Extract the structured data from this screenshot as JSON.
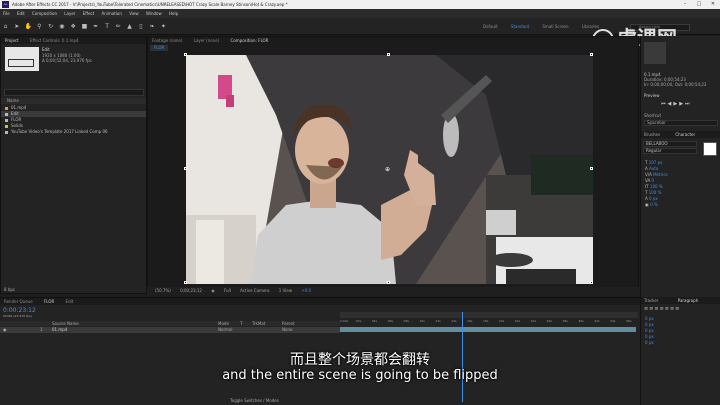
{
  "app": {
    "title": "Adobe After Effects CC 2017 - V:\\Projects\\_YouTube\\Tolerated Cinematics\\UNRELEASED\\HOT Crazy Scale Barney Stinson\\Hot & Crazy.aep *",
    "logo_text": "Ae"
  },
  "menu": [
    "File",
    "Edit",
    "Composition",
    "Layer",
    "Effect",
    "Animation",
    "View",
    "Window",
    "Help"
  ],
  "workspaces": {
    "items": [
      "Default",
      "Standard",
      "Small Screen",
      "Libraries"
    ],
    "active_index": 1,
    "search_placeholder": "Search Help"
  },
  "project_panel": {
    "tabs": [
      "Project",
      "Effect Controls: 0.1.mp4"
    ],
    "selected_name": "Edit",
    "selected_info_1": "1920 x 1080 (1.00)",
    "selected_info_2": "Δ 0;00;52;04, 23.976 fps",
    "header_name": "Name",
    "items": [
      {
        "name": "01.mp4",
        "color": "#d4a23a",
        "selected": false
      },
      {
        "name": "Edit",
        "color": "#b8b8b8",
        "selected": true
      },
      {
        "name": "FLOR",
        "color": "#b8b8b8",
        "selected": false
      },
      {
        "name": "Solids",
        "color": "#d4c23a",
        "selected": false
      },
      {
        "name": "YouTube Video's Template 2017 Linked Comp 06",
        "color": "#b8b8b8",
        "selected": false
      }
    ],
    "bpc": "8 bpc"
  },
  "viewer": {
    "tabs": [
      "Footage (none)",
      "Layer (none)",
      "Composition: FLOR"
    ],
    "breadcrumb": "FLOR",
    "bottom_items": [
      "(50.7%)",
      "0;00;23;12",
      "Full",
      "Active Camera",
      "1 View",
      "+0.0"
    ]
  },
  "right_panel": {
    "info_lines": [
      "0.1.mp4",
      "Duration: 0;00;54;23",
      "In: 0;00;00;00, Out: 0;00;54;23"
    ],
    "preview_label": "Preview",
    "shortcut_label": "Shortcut",
    "shortcut_value": "Spacebar",
    "character_tabs": [
      "Brushes",
      "Character"
    ],
    "font_name": "BELLABOO",
    "font_style": "Regular",
    "char_values": [
      "107 px",
      "Auto",
      "Metrics",
      "0",
      "100 %",
      "100 %",
      "0 px",
      "0 %"
    ],
    "bottom_tabs": [
      "Tracker",
      "Paragraph"
    ],
    "para_values": [
      "0 px",
      "0 px",
      "0 px",
      "0 px",
      "0 px"
    ]
  },
  "timeline": {
    "tabs": [
      "Render Queue",
      "FLOR",
      "Edit"
    ],
    "active_tab": 1,
    "timecode": "0:00:23:12",
    "timecode_sub": "00362 (23.976 fps)",
    "columns": [
      "Source Name",
      "Mode",
      "T",
      "TrkMat",
      "Parent"
    ],
    "layer": {
      "index": "1",
      "name": "01.mp4",
      "mode": "Normal",
      "parent": "None"
    },
    "ruler": [
      "0:00s",
      "02s",
      "04s",
      "06s",
      "08s",
      "10s",
      "12s",
      "14s",
      "16s",
      "18s",
      "20s",
      "22s",
      "24s",
      "26s",
      "28s",
      "30s",
      "32s",
      "34s",
      "36s"
    ],
    "playhead_fraction": 0.41,
    "bottom_label": "Toggle Switches / Modes"
  },
  "subtitles": {
    "cn": "而且整个场景都会翻转",
    "en": "and the entire scene is going to be flipped"
  },
  "watermark": "虎课网",
  "colors": {
    "accent_blue": "#3f8fe6",
    "timeline_bar": "#5f8fa0",
    "playhead": "#3f8fe6"
  }
}
